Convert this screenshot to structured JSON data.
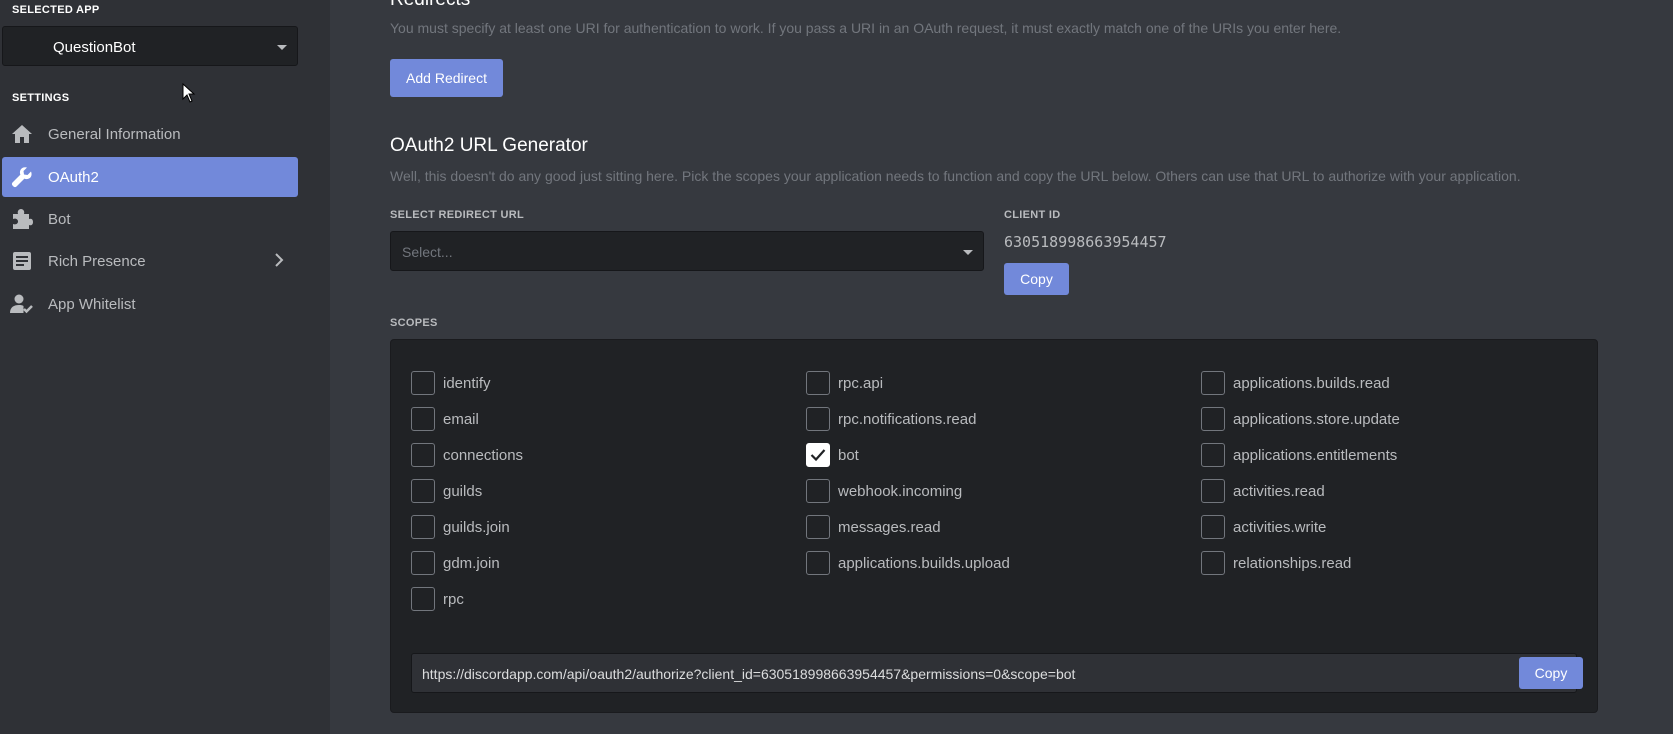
{
  "sidebar": {
    "selected_app_label": "SELECTED APP",
    "app_name": "QuestionBot",
    "settings_label": "SETTINGS",
    "items": [
      {
        "label": "General Information",
        "icon": "home-icon"
      },
      {
        "label": "OAuth2",
        "icon": "wrench-icon",
        "active": true
      },
      {
        "label": "Bot",
        "icon": "puzzle-icon"
      },
      {
        "label": "Rich Presence",
        "icon": "document-icon",
        "has_submenu": true
      },
      {
        "label": "App Whitelist",
        "icon": "user-check-icon"
      }
    ]
  },
  "redirects": {
    "heading": "Redirects",
    "description": "You must specify at least one URI for authentication to work. If you pass a URI in an OAuth request, it must exactly match one of the URIs you enter here.",
    "add_button": "Add Redirect"
  },
  "generator": {
    "heading": "OAuth2 URL Generator",
    "description": "Well, this doesn't do any good just sitting here. Pick the scopes your application needs to function and copy the URL below. Others can use that URL to authorize with your application.",
    "redirect_label": "SELECT REDIRECT URL",
    "redirect_placeholder": "Select...",
    "client_id_label": "CLIENT ID",
    "client_id": "630518998663954457",
    "copy_label": "Copy"
  },
  "scopes": {
    "label": "SCOPES",
    "columns": [
      [
        {
          "name": "identify",
          "checked": false
        },
        {
          "name": "email",
          "checked": false
        },
        {
          "name": "connections",
          "checked": false
        },
        {
          "name": "guilds",
          "checked": false
        },
        {
          "name": "guilds.join",
          "checked": false
        },
        {
          "name": "gdm.join",
          "checked": false
        },
        {
          "name": "rpc",
          "checked": false
        }
      ],
      [
        {
          "name": "rpc.api",
          "checked": false
        },
        {
          "name": "rpc.notifications.read",
          "checked": false
        },
        {
          "name": "bot",
          "checked": true
        },
        {
          "name": "webhook.incoming",
          "checked": false
        },
        {
          "name": "messages.read",
          "checked": false
        },
        {
          "name": "applications.builds.upload",
          "checked": false
        }
      ],
      [
        {
          "name": "applications.builds.read",
          "checked": false
        },
        {
          "name": "applications.store.update",
          "checked": false
        },
        {
          "name": "applications.entitlements",
          "checked": false
        },
        {
          "name": "activities.read",
          "checked": false
        },
        {
          "name": "activities.write",
          "checked": false
        },
        {
          "name": "relationships.read",
          "checked": false
        }
      ]
    ],
    "generated_url": "https://discordapp.com/api/oauth2/authorize?client_id=630518998663954457&permissions=0&scope=bot",
    "copy_label": "Copy"
  },
  "colors": {
    "accent": "#7289da",
    "sidebar_bg": "#2f3136",
    "main_bg": "#36393f",
    "input_bg": "#202225"
  }
}
